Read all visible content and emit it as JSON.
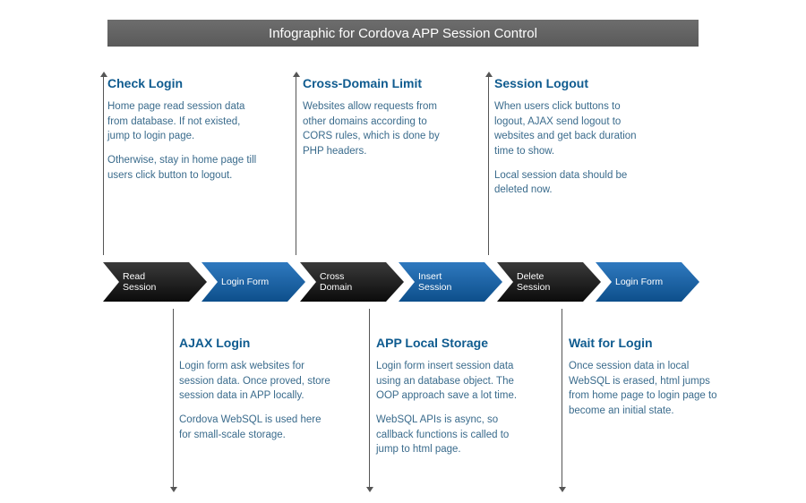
{
  "title": "Infographic for Cordova APP Session Control",
  "topBlocks": [
    {
      "title": "Check Login",
      "p1": "Home page read session data from database. If not existed, jump to login page.",
      "p2": "Otherwise, stay in home page till users click button to logout."
    },
    {
      "title": "Cross-Domain Limit",
      "p1": "Websites allow requests from other domains according to CORS rules, which is done by PHP headers.",
      "p2": ""
    },
    {
      "title": "Session Logout",
      "p1": "When users click buttons to logout, AJAX send logout to websites and get back duration time to show.",
      "p2": "Local session data should be deleted now."
    }
  ],
  "bottomBlocks": [
    {
      "title": "AJAX Login",
      "p1": "Login form ask websites for session data. Once proved, store session data in APP locally.",
      "p2": "Cordova WebSQL is used here for small-scale storage."
    },
    {
      "title": "APP Local Storage",
      "p1": "Login form insert session data using an database object. The OOP approach save a lot time.",
      "p2": "WebSQL APIs is async, so callback functions is called to jump to html page."
    },
    {
      "title": "Wait for Login",
      "p1": "Once session data in local WebSQL is erased, html jumps from home page to login page to become an initial state.",
      "p2": ""
    }
  ],
  "flow": [
    {
      "label": "Read Session",
      "color": "dark"
    },
    {
      "label": "Login Form",
      "color": "blue"
    },
    {
      "label": "Cross Domain",
      "color": "dark"
    },
    {
      "label": "Insert Session",
      "color": "blue"
    },
    {
      "label": "Delete Session",
      "color": "dark"
    },
    {
      "label": "Login Form",
      "color": "blue"
    }
  ],
  "colors": {
    "accent": "#0f5b8f",
    "text": "#3a6b8c"
  }
}
